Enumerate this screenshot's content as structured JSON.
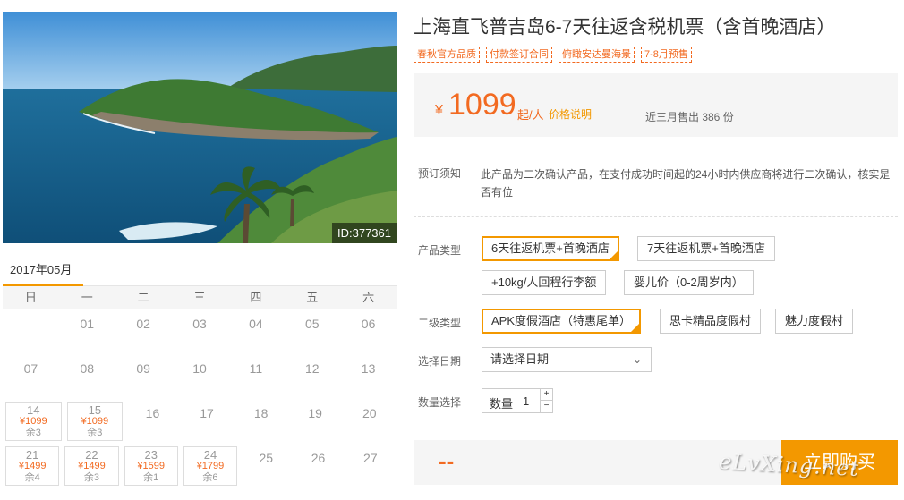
{
  "photo": {
    "id_label": "ID:377361"
  },
  "calendar": {
    "month_tab": "2017年05月",
    "weekdays": [
      "日",
      "一",
      "二",
      "三",
      "四",
      "五",
      "六"
    ],
    "rows": [
      [
        {
          "d": ""
        },
        {
          "d": "01"
        },
        {
          "d": "02"
        },
        {
          "d": "03"
        },
        {
          "d": "04"
        },
        {
          "d": "05"
        },
        {
          "d": "06"
        }
      ],
      [
        {
          "d": "07"
        },
        {
          "d": "08"
        },
        {
          "d": "09"
        },
        {
          "d": "10"
        },
        {
          "d": "11"
        },
        {
          "d": "12"
        },
        {
          "d": "13"
        }
      ],
      [
        {
          "d": "14",
          "p": "¥1099",
          "r": "余3"
        },
        {
          "d": "15",
          "p": "¥1099",
          "r": "余3"
        },
        {
          "d": "16"
        },
        {
          "d": "17"
        },
        {
          "d": "18"
        },
        {
          "d": "19"
        },
        {
          "d": "20"
        }
      ],
      [
        {
          "d": "21",
          "p": "¥1499",
          "r": "余4"
        },
        {
          "d": "22",
          "p": "¥1499",
          "r": "余3"
        },
        {
          "d": "23",
          "p": "¥1599",
          "r": "余1"
        },
        {
          "d": "24",
          "p": "¥1799",
          "r": "余6"
        },
        {
          "d": "25"
        },
        {
          "d": "26"
        },
        {
          "d": "27"
        }
      ]
    ]
  },
  "product": {
    "title": "上海直飞普吉岛6-7天往返含税机票（含首晚酒店）",
    "tags": [
      "春秋官方品质",
      "付款签订合同",
      "俯瞰安达曼海景",
      "7-8月预售"
    ]
  },
  "price": {
    "currency": "¥",
    "amount": "1099",
    "unit": "起/人",
    "note_link": "价格说明",
    "sold": "近三月售出 386 份"
  },
  "notice": {
    "label": "预订须知",
    "text": "此产品为二次确认产品，在支付成功时间起的24小时内供应商将进行二次确认，核实是否有位"
  },
  "options": {
    "product_type_label": "产品类型",
    "product_types": [
      "6天往返机票+首晚酒店",
      "7天往返机票+首晚酒店",
      "+10kg/人回程行李额",
      "婴儿价（0-2周岁内）"
    ],
    "sub_type_label": "二级类型",
    "sub_types": [
      "APK度假酒店（特惠尾单）",
      "思卡精品度假村",
      "魅力度假村"
    ],
    "date_label": "选择日期",
    "date_placeholder": "请选择日期",
    "qty_label": "数量选择",
    "qty_inner_label": "数量",
    "qty_value": "1"
  },
  "purchase": {
    "total": "--",
    "buy_label": "立即购买",
    "watermark": "eLvXing.net"
  },
  "colors": {
    "accent": "#f39800",
    "price": "#f26a21"
  }
}
